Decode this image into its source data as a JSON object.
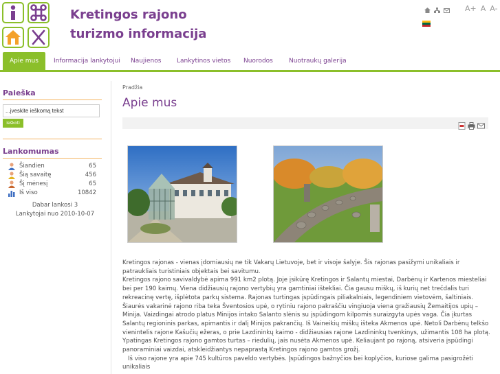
{
  "header": {
    "title_line1": "Kretingos rajono",
    "title_line2": "turizmo informacija",
    "top_icons": [
      "home-icon",
      "sitemap-icon",
      "email-icon"
    ],
    "font_size_labels": [
      "A+",
      "A",
      "A-"
    ],
    "language": "lt"
  },
  "nav": {
    "items": [
      {
        "label": "Apie mus",
        "active": true
      },
      {
        "label": "Informacija lankytojui"
      },
      {
        "label": "Naujienos"
      },
      {
        "label": "Lankytinos vietos"
      },
      {
        "label": "Nuorodos"
      },
      {
        "label": "Nuotraukų galerija"
      }
    ]
  },
  "sidebar": {
    "search_title": "Paieška",
    "search_placeholder": "...įveskite ieškomą tekst",
    "search_button": "Ieškoti",
    "stats_title": "Lankomumas",
    "stats": [
      {
        "label": "Šiandien",
        "value": "65"
      },
      {
        "label": "Šią savaitę",
        "value": "456"
      },
      {
        "label": "Šį mėnesį",
        "value": "65"
      },
      {
        "label": "Iš viso",
        "value": "10842"
      }
    ],
    "now_online": "Dabar lankosi  3",
    "since": "Lankytojai nuo 2010-10-07"
  },
  "main": {
    "breadcrumb": "Pradžia",
    "title": "Apie mus",
    "toolbar_icons": [
      "pdf-icon",
      "print-icon",
      "email-icon"
    ],
    "paragraphs": [
      "Kretingos rajonas - vienas įdomiausių ne tik Vakarų Lietuvoje, bet ir visoje šalyje. Šis rajonas pasižymi unikaliais ir patraukliais turistiniais objektais bei savitumu.",
      "Kretingos rajono savivaldybė apima 991 km2 plotą. Joje įsikūrę Kretingos ir Salantų miestai, Darbėnų ir Kartenos miesteliai bei per 190 kaimų. Viena didžiausių rajono vertybių yra gamtiniai ištekliai. Čia gausu miškų, iš kurių net trečdalis turi rekreacinę vertę, išplėtota parkų sistema. Rajonas turtingas įspūdingais piliakalniais, legendiniem vietovėm, šaltiniais. Šiaurės vakarinė rajono riba teka Šventosios upė, o rytiniu rajono pakraščiu vingiuoja viena gražiausių Žemaitijos upių – Minija. Vaizdingai atrodo platus Minijos intako Salanto slėnis su įspūdingom kilpomis suraizgyta upės vaga. Čia įkurtas Salantų regioninis parkas, apimantis ir dalį Minijos pakrančių. Iš Vaineikių miškų išteka Akmenos upė. Netoli Darbėnų telkšo vienintelis rajone Kašučių ežeras, o prie Lazdininkų kaimo - didžiausias rajone Lazdininkų tvenkinys, užimantis 108 ha plotą. Ypatingas Kretingos rajono gamtos turtas – riedulių, jais nusėta Akmenos upė. Keliaujant po rajoną, atsiveria įspūdingi panoraminiai vaizdai, atskleidžiantys nepaprastą Kretingos rajono gamtos grožį.",
      "Iš viso rajone yra apie 745 kultūros paveldo vertybės. Įspūdingos bažnyčios bei koplyčios, kuriose galima pasigrožėti unikaliais"
    ]
  },
  "colors": {
    "accent": "#8bbf2a",
    "brand": "#7a3f8f",
    "divider": "#f4b35e"
  }
}
